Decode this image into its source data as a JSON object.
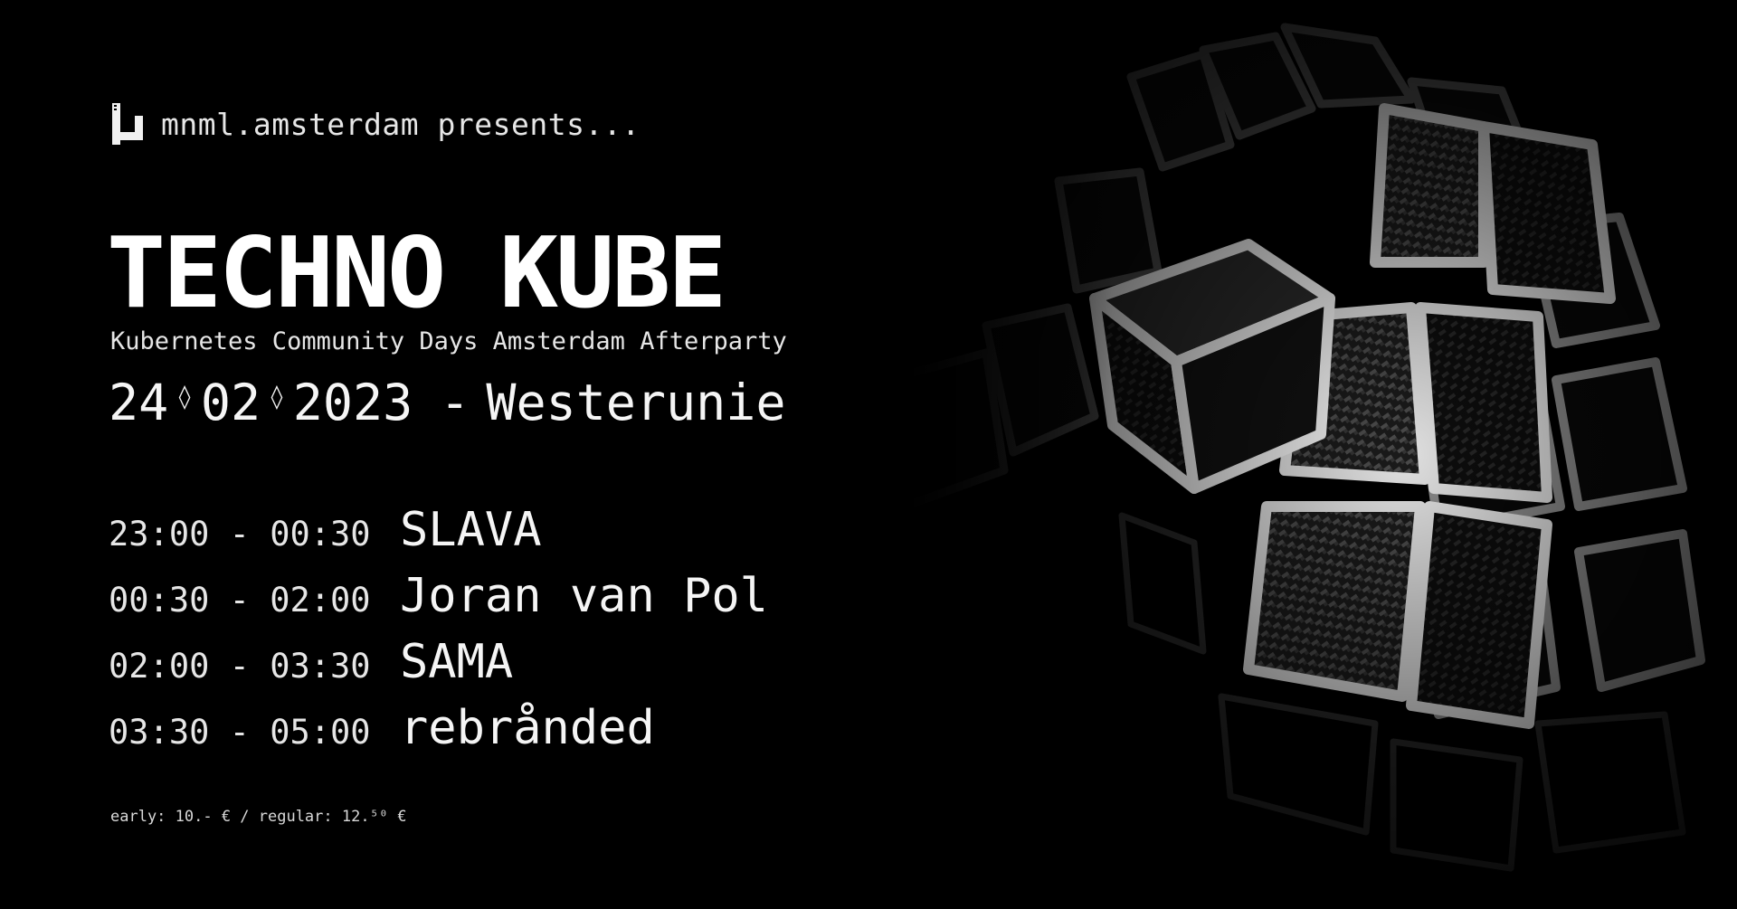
{
  "header": {
    "presenter": "mnml.amsterdam presents..."
  },
  "event": {
    "title": "TECHNO KUBE",
    "subtitle": "Kubernetes Community Days Amsterdam Afterparty",
    "date_day": "24",
    "date_month": "02",
    "date_year": "2023",
    "date_separator": "◊",
    "venue_dash": "-",
    "venue": "Westerunie"
  },
  "lineup": [
    {
      "time": "23:00 - 00:30",
      "artist": "SLAVA"
    },
    {
      "time": "00:30 - 02:00",
      "artist": "Joran van Pol"
    },
    {
      "time": "02:00 - 03:30",
      "artist": "SAMA"
    },
    {
      "time": "03:30 - 05:00",
      "artist": "rebrånded"
    }
  ],
  "prices": {
    "text": "early: 10.- € / regular: 12.⁵⁰ €"
  },
  "colors": {
    "background": "#000000",
    "text": "#f2f2f2"
  },
  "icons": {
    "logo": "mu-logo-icon",
    "artwork": "rubiks-cube-image"
  }
}
